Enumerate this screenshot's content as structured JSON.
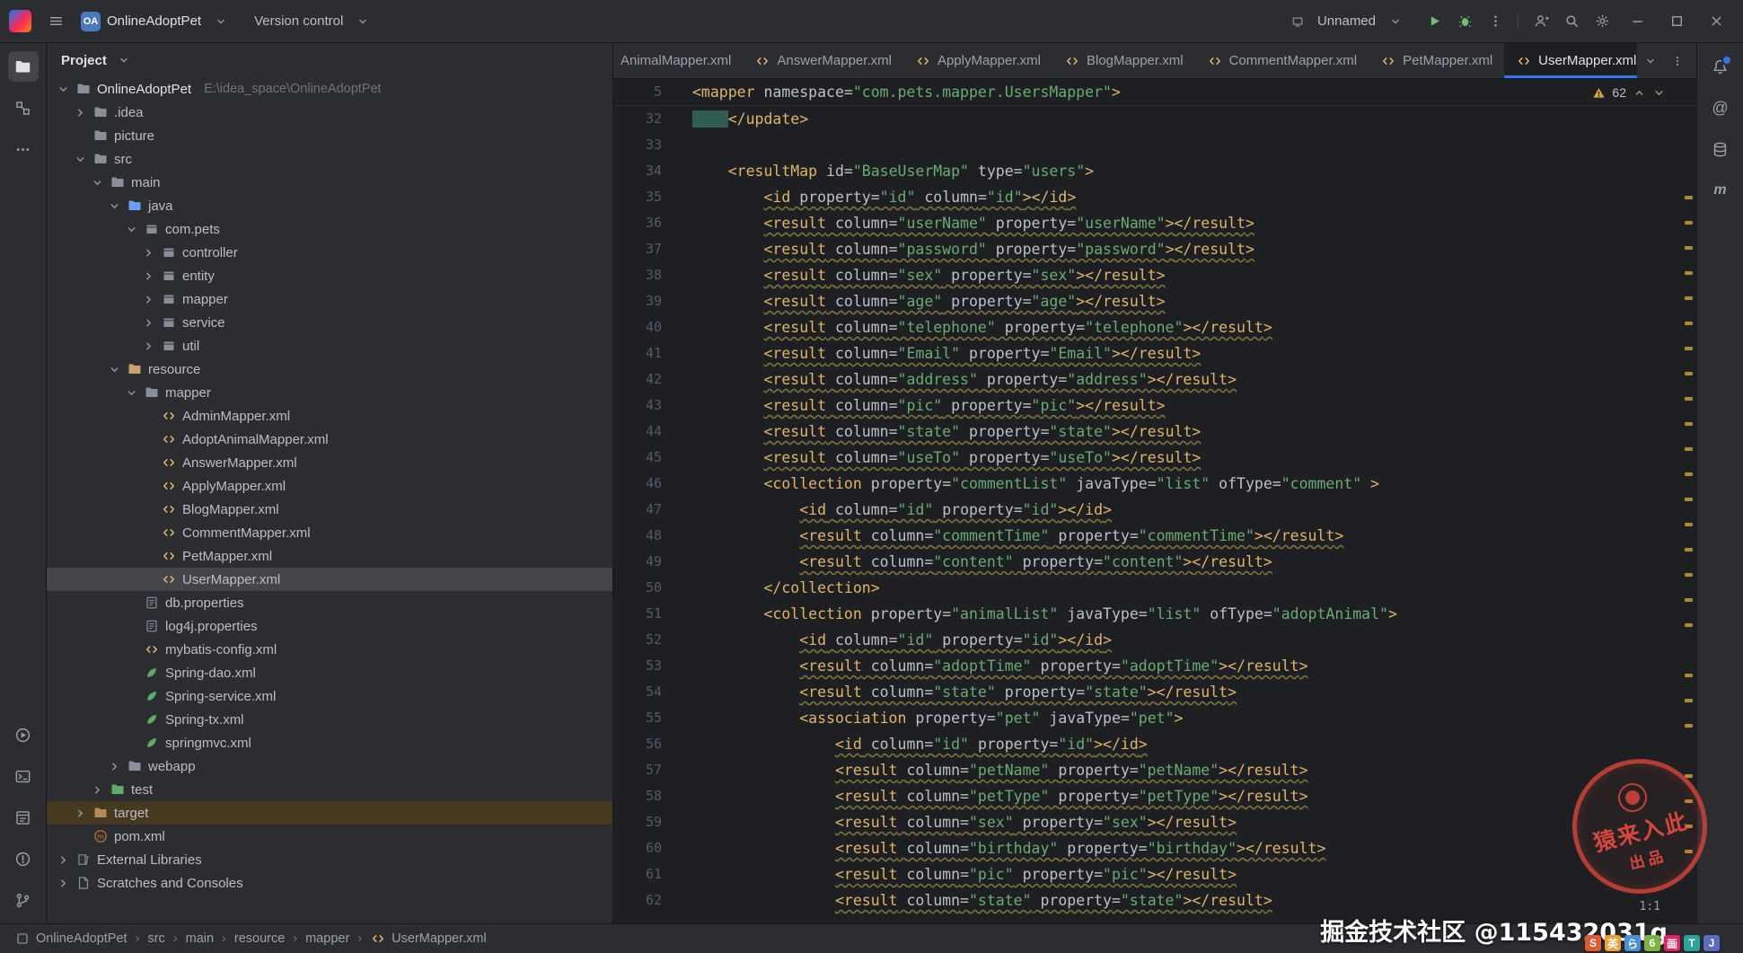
{
  "colors": {
    "accent": "#3574f0",
    "badge": "#4a78bf",
    "warning": "#d9a343",
    "tag": "#e0b568",
    "string": "#6aab73",
    "attr": "#bdc1c7",
    "run_green": "#73bd79",
    "stamp": "#d8453a"
  },
  "title_bar": {
    "project_badge": "OA",
    "project_name": "OnlineAdoptPet",
    "version_control": "Version control",
    "run_config": "Unnamed"
  },
  "project_panel": {
    "header": "Project",
    "tree": [
      {
        "d": 0,
        "ch": "down",
        "ic": "folder",
        "label": "OnlineAdoptPet",
        "extra": "E:\\idea_space\\OnlineAdoptPet",
        "bold": true
      },
      {
        "d": 1,
        "ch": "right",
        "ic": "folder",
        "label": ".idea"
      },
      {
        "d": 1,
        "ch": "",
        "ic": "folder",
        "label": "picture"
      },
      {
        "d": 1,
        "ch": "down",
        "ic": "folder",
        "label": "src"
      },
      {
        "d": 2,
        "ch": "down",
        "ic": "folder",
        "label": "main"
      },
      {
        "d": 3,
        "ch": "down",
        "ic": "folder",
        "tint": "#6c9ef8",
        "label": "java"
      },
      {
        "d": 4,
        "ch": "down",
        "ic": "package",
        "label": "com.pets"
      },
      {
        "d": 5,
        "ch": "right",
        "ic": "package",
        "label": "controller"
      },
      {
        "d": 5,
        "ch": "right",
        "ic": "package",
        "label": "entity"
      },
      {
        "d": 5,
        "ch": "right",
        "ic": "package",
        "label": "mapper"
      },
      {
        "d": 5,
        "ch": "right",
        "ic": "package",
        "label": "service"
      },
      {
        "d": 5,
        "ch": "right",
        "ic": "package",
        "label": "util"
      },
      {
        "d": 3,
        "ch": "down",
        "ic": "folder",
        "tint": "#c9a26d",
        "label": "resource"
      },
      {
        "d": 4,
        "ch": "down",
        "ic": "folder",
        "label": "mapper"
      },
      {
        "d": 5,
        "ch": "",
        "ic": "xml",
        "label": "AdminMapper.xml"
      },
      {
        "d": 5,
        "ch": "",
        "ic": "xml",
        "label": "AdoptAnimalMapper.xml"
      },
      {
        "d": 5,
        "ch": "",
        "ic": "xml",
        "label": "AnswerMapper.xml"
      },
      {
        "d": 5,
        "ch": "",
        "ic": "xml",
        "label": "ApplyMapper.xml"
      },
      {
        "d": 5,
        "ch": "",
        "ic": "xml",
        "label": "BlogMapper.xml"
      },
      {
        "d": 5,
        "ch": "",
        "ic": "xml",
        "label": "CommentMapper.xml"
      },
      {
        "d": 5,
        "ch": "",
        "ic": "xml",
        "label": "PetMapper.xml"
      },
      {
        "d": 5,
        "ch": "",
        "ic": "xml",
        "label": "UserMapper.xml",
        "state": "selected"
      },
      {
        "d": 4,
        "ch": "",
        "ic": "props",
        "label": "db.properties"
      },
      {
        "d": 4,
        "ch": "",
        "ic": "props",
        "label": "log4j.properties"
      },
      {
        "d": 4,
        "ch": "",
        "ic": "xml",
        "label": "mybatis-config.xml"
      },
      {
        "d": 4,
        "ch": "",
        "ic": "leaf",
        "label": "Spring-dao.xml"
      },
      {
        "d": 4,
        "ch": "",
        "ic": "leaf",
        "label": "Spring-service.xml"
      },
      {
        "d": 4,
        "ch": "",
        "ic": "leaf",
        "label": "Spring-tx.xml"
      },
      {
        "d": 4,
        "ch": "",
        "ic": "leaf",
        "label": "springmvc.xml"
      },
      {
        "d": 3,
        "ch": "right",
        "ic": "folder",
        "label": "webapp"
      },
      {
        "d": 2,
        "ch": "right",
        "ic": "folder",
        "tint": "#5fad65",
        "label": "test"
      },
      {
        "d": 1,
        "ch": "right",
        "ic": "folder",
        "tint": "#b38c5a",
        "label": "target",
        "state": "highlighted"
      },
      {
        "d": 1,
        "ch": "",
        "ic": "maven",
        "label": "pom.xml"
      },
      {
        "d": 0,
        "ch": "right",
        "ic": "libs",
        "label": "External Libraries"
      },
      {
        "d": 0,
        "ch": "right",
        "ic": "scratch",
        "label": "Scratches and Consoles"
      }
    ]
  },
  "editor": {
    "tabs": [
      {
        "label": "AnimalMapper.xml"
      },
      {
        "label": "AnswerMapper.xml"
      },
      {
        "label": "ApplyMapper.xml"
      },
      {
        "label": "BlogMapper.xml"
      },
      {
        "label": "CommentMapper.xml"
      },
      {
        "label": "PetMapper.xml"
      },
      {
        "label": "UserMapper.xml",
        "active": true
      }
    ],
    "sticky_line": {
      "n": 5,
      "t": "<mapper namespace=\"com.pets.mapper.UsersMapper\">"
    },
    "inspections": {
      "count": "62"
    },
    "lines": [
      {
        "n": 32,
        "t": "    </update>",
        "sel": 4
      },
      {
        "n": 33,
        "t": ""
      },
      {
        "n": 34,
        "t": "    <resultMap id=\"BaseUserMap\" type=\"users\">"
      },
      {
        "n": 35,
        "t": "        <id property=\"id\" column=\"id\"></id>",
        "w": 1
      },
      {
        "n": 36,
        "t": "        <result column=\"userName\" property=\"userName\"></result>",
        "w": 1
      },
      {
        "n": 37,
        "t": "        <result column=\"password\" property=\"password\"></result>",
        "w": 1
      },
      {
        "n": 38,
        "t": "        <result column=\"sex\" property=\"sex\"></result>",
        "w": 1
      },
      {
        "n": 39,
        "t": "        <result column=\"age\" property=\"age\"></result>",
        "w": 1
      },
      {
        "n": 40,
        "t": "        <result column=\"telephone\" property=\"telephone\"></result>",
        "w": 1
      },
      {
        "n": 41,
        "t": "        <result column=\"Email\" property=\"Email\"></result>",
        "w": 1
      },
      {
        "n": 42,
        "t": "        <result column=\"address\" property=\"address\"></result>",
        "w": 1
      },
      {
        "n": 43,
        "t": "        <result column=\"pic\" property=\"pic\"></result>",
        "w": 1
      },
      {
        "n": 44,
        "t": "        <result column=\"state\" property=\"state\"></result>",
        "w": 1
      },
      {
        "n": 45,
        "t": "        <result column=\"useTo\" property=\"useTo\"></result>",
        "w": 1
      },
      {
        "n": 46,
        "t": "        <collection property=\"commentList\" javaType=\"list\" ofType=\"comment\" >"
      },
      {
        "n": 47,
        "t": "            <id column=\"id\" property=\"id\"></id>",
        "w": 1
      },
      {
        "n": 48,
        "t": "            <result column=\"commentTime\" property=\"commentTime\"></result>",
        "w": 1
      },
      {
        "n": 49,
        "t": "            <result column=\"content\" property=\"content\"></result>",
        "w": 1
      },
      {
        "n": 50,
        "t": "        </collection>"
      },
      {
        "n": 51,
        "t": "        <collection property=\"animalList\" javaType=\"list\" ofType=\"adoptAnimal\">"
      },
      {
        "n": 52,
        "t": "            <id column=\"id\" property=\"id\"></id>",
        "w": 1
      },
      {
        "n": 53,
        "t": "            <result column=\"adoptTime\" property=\"adoptTime\"></result>",
        "w": 1
      },
      {
        "n": 54,
        "t": "            <result column=\"state\" property=\"state\"></result>",
        "w": 1
      },
      {
        "n": 55,
        "t": "            <association property=\"pet\" javaType=\"pet\">"
      },
      {
        "n": 56,
        "t": "                <id column=\"id\" property=\"id\"></id>",
        "w": 1
      },
      {
        "n": 57,
        "t": "                <result column=\"petName\" property=\"petName\"></result>",
        "w": 1
      },
      {
        "n": 58,
        "t": "                <result column=\"petType\" property=\"petType\"></result>",
        "w": 1
      },
      {
        "n": 59,
        "t": "                <result column=\"sex\" property=\"sex\"></result>",
        "w": 1
      },
      {
        "n": 60,
        "t": "                <result column=\"birthday\" property=\"birthday\"></result>",
        "w": 1
      },
      {
        "n": 61,
        "t": "                <result column=\"pic\" property=\"pic\"></result>",
        "w": 1
      },
      {
        "n": 62,
        "t": "                <result column=\"state\" property=\"state\"></result>",
        "w": 1
      }
    ],
    "error_stripe_marks": [
      130,
      158,
      186,
      214,
      242,
      270,
      298,
      326,
      354,
      382,
      410,
      438,
      466,
      494,
      522,
      550,
      578,
      606,
      662,
      690,
      718,
      774,
      802,
      830,
      858
    ]
  },
  "right_stripe": {
    "mentions": "@",
    "maven": "m"
  },
  "status_bar": {
    "breadcrumbs": [
      {
        "icon": "module",
        "label": "OnlineAdoptPet"
      },
      {
        "label": "src"
      },
      {
        "label": "main"
      },
      {
        "label": "resource"
      },
      {
        "label": "mapper"
      },
      {
        "icon": "xml",
        "label": "UserMapper.xml"
      }
    ],
    "caret": "1:1"
  },
  "watermark": {
    "text": "掘金技术社区 @115432031g",
    "stamp_line1": "猿来入此",
    "stamp_line2": "出品",
    "logos": [
      {
        "ch": "S",
        "bg": "#e05a33"
      },
      {
        "ch": "英",
        "bg": "#f0a030"
      },
      {
        "ch": "ら",
        "bg": "#4a90d9"
      },
      {
        "ch": "6",
        "bg": "#7cb342"
      },
      {
        "ch": "画",
        "bg": "#e91e63"
      },
      {
        "ch": "T",
        "bg": "#26a69a"
      },
      {
        "ch": "J",
        "bg": "#5c6bc0"
      }
    ]
  }
}
